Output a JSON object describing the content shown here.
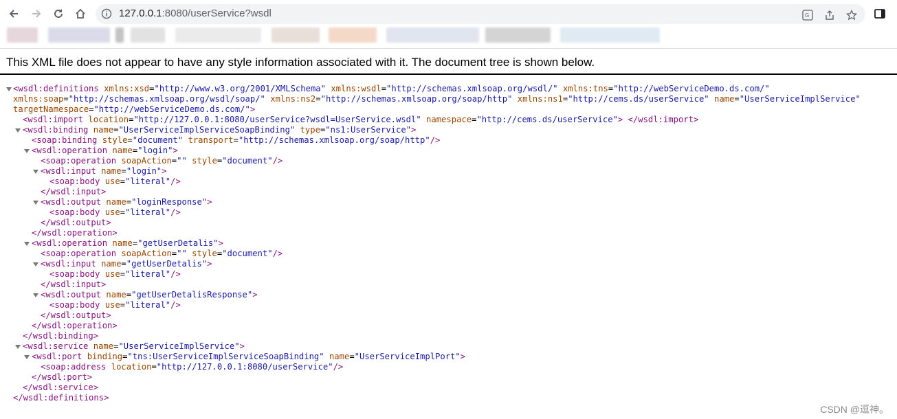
{
  "browser": {
    "url_host": "127.0.0.1",
    "url_rest": ":8080/userService?wsdl",
    "nav_icons": [
      "back-arrow-icon",
      "forward-arrow-icon",
      "reload-icon",
      "home-icon"
    ],
    "omnibox_icons": [
      "translate-icon",
      "share-icon",
      "star-icon"
    ],
    "side_panel_icon": "side-panel-icon"
  },
  "banner": {
    "message": "This XML file does not appear to have any style information associated with it. The document tree is shown below."
  },
  "xml": {
    "l1": {
      "open": "<wsdl:definitions",
      "a1n": "xmlns:xsd",
      "a1v": "\"http://www.w3.org/2001/XMLSchema\"",
      "a2n": "xmlns:wsdl",
      "a2v": "\"http://schemas.xmlsoap.org/wsdl/\"",
      "a3n": "xmlns:tns",
      "a3v": "\"http://webServiceDemo.ds.com/\""
    },
    "l2": {
      "a1n": "xmlns:soap",
      "a1v": "\"http://schemas.xmlsoap.org/wsdl/soap/\"",
      "a2n": "xmlns:ns2",
      "a2v": "\"http://schemas.xmlsoap.org/soap/http\"",
      "a3n": "xmlns:ns1",
      "a3v": "\"http://cems.ds/userService\"",
      "a4n": "name",
      "a4v": "\"UserServiceImplService\""
    },
    "l3": {
      "a1n": "targetNamespace",
      "a1v": "\"http://webServiceDemo.ds.com/\"",
      "close": ">"
    },
    "l4": {
      "open": "<wsdl:import",
      "a1n": "location",
      "a1v": "\"http://127.0.0.1:8080/userService?wsdl=UserService.wsdl\"",
      "a2n": "namespace",
      "a2v": "\"http://cems.ds/userService\"",
      "close": "> </wsdl:import>"
    },
    "l5": {
      "open": "<wsdl:binding",
      "a1n": "name",
      "a1v": "\"UserServiceImplServiceSoapBinding\"",
      "a2n": "type",
      "a2v": "\"ns1:UserService\"",
      "close": ">"
    },
    "l6": {
      "open": "<soap:binding",
      "a1n": "style",
      "a1v": "\"document\"",
      "a2n": "transport",
      "a2v": "\"http://schemas.xmlsoap.org/soap/http\"",
      "close": "/>"
    },
    "l7": {
      "open": "<wsdl:operation",
      "a1n": "name",
      "a1v": "\"login\"",
      "close": ">"
    },
    "l8": {
      "open": "<soap:operation",
      "a1n": "soapAction",
      "a1v": "\"\"",
      "a2n": "style",
      "a2v": "\"document\"",
      "close": "/>"
    },
    "l9": {
      "open": "<wsdl:input",
      "a1n": "name",
      "a1v": "\"login\"",
      "close": ">"
    },
    "l10": {
      "open": "<soap:body",
      "a1n": "use",
      "a1v": "\"literal\"",
      "close": "/>"
    },
    "l11": {
      "text": "</wsdl:input>"
    },
    "l12": {
      "open": "<wsdl:output",
      "a1n": "name",
      "a1v": "\"loginResponse\"",
      "close": ">"
    },
    "l13": {
      "open": "<soap:body",
      "a1n": "use",
      "a1v": "\"literal\"",
      "close": "/>"
    },
    "l14": {
      "text": "</wsdl:output>"
    },
    "l15": {
      "text": "</wsdl:operation>"
    },
    "l16": {
      "open": "<wsdl:operation",
      "a1n": "name",
      "a1v": "\"getUserDetalis\"",
      "close": ">"
    },
    "l17": {
      "open": "<soap:operation",
      "a1n": "soapAction",
      "a1v": "\"\"",
      "a2n": "style",
      "a2v": "\"document\"",
      "close": "/>"
    },
    "l18": {
      "open": "<wsdl:input",
      "a1n": "name",
      "a1v": "\"getUserDetalis\"",
      "close": ">"
    },
    "l19": {
      "open": "<soap:body",
      "a1n": "use",
      "a1v": "\"literal\"",
      "close": "/>"
    },
    "l20": {
      "text": "</wsdl:input>"
    },
    "l21": {
      "open": "<wsdl:output",
      "a1n": "name",
      "a1v": "\"getUserDetalisResponse\"",
      "close": ">"
    },
    "l22": {
      "open": "<soap:body",
      "a1n": "use",
      "a1v": "\"literal\"",
      "close": "/>"
    },
    "l23": {
      "text": "</wsdl:output>"
    },
    "l24": {
      "text": "</wsdl:operation>"
    },
    "l25": {
      "text": "</wsdl:binding>"
    },
    "l26": {
      "open": "<wsdl:service",
      "a1n": "name",
      "a1v": "\"UserServiceImplService\"",
      "close": ">"
    },
    "l27": {
      "open": "<wsdl:port",
      "a1n": "binding",
      "a1v": "\"tns:UserServiceImplServiceSoapBinding\"",
      "a2n": "name",
      "a2v": "\"UserServiceImplPort\"",
      "close": ">"
    },
    "l28": {
      "open": "<soap:address",
      "a1n": "location",
      "a1v": "\"http://127.0.0.1:8080/userService\"",
      "close": "/>"
    },
    "l29": {
      "text": "</wsdl:port>"
    },
    "l30": {
      "text": "</wsdl:service>"
    },
    "l31": {
      "text": "</wsdl:definitions>"
    }
  },
  "watermark": "CSDN @逗神。"
}
